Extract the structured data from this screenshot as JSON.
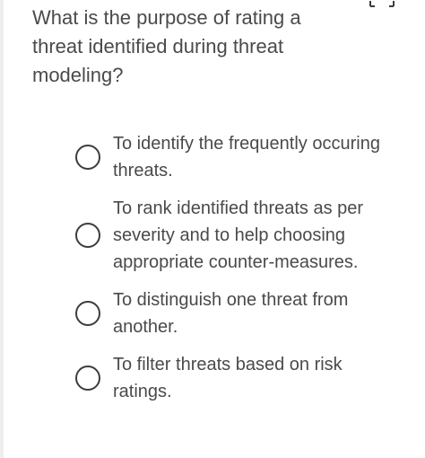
{
  "question": {
    "text": "What is the purpose of rating a threat identified during threat modeling?"
  },
  "header": {
    "expand_icon": "expand-icon"
  },
  "options": [
    {
      "label": "To identify the frequently occuring threats.",
      "selected": false
    },
    {
      "label": "To rank identified threats as per severity and to help choosing appropriate counter-measures.",
      "selected": false
    },
    {
      "label": "To distinguish one threat from another.",
      "selected": false
    },
    {
      "label": "To filter threats based on risk ratings.",
      "selected": false
    }
  ],
  "colors": {
    "text": "#4a4a4a",
    "radio_border": "#3d3d3d",
    "background": "#ffffff"
  }
}
